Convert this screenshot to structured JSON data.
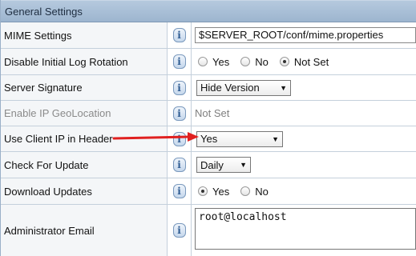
{
  "section_title": "General Settings",
  "rows": {
    "mime": {
      "label": "MIME Settings",
      "value": "$SERVER_ROOT/conf/mime.properties"
    },
    "log_rotation": {
      "label": "Disable Initial Log Rotation",
      "options": [
        "Yes",
        "No",
        "Not Set"
      ],
      "selected": "Not Set"
    },
    "server_signature": {
      "label": "Server Signature",
      "value": "Hide Version"
    },
    "geo_location": {
      "label": "Enable IP GeoLocation",
      "value": "Not Set"
    },
    "client_ip_header": {
      "label": "Use Client IP in Header",
      "value": "Yes"
    },
    "check_update": {
      "label": "Check For Update",
      "value": "Daily"
    },
    "download_updates": {
      "label": "Download Updates",
      "options": [
        "Yes",
        "No"
      ],
      "selected": "Yes"
    },
    "admin_email": {
      "label": "Administrator Email",
      "value": "root@localhost"
    }
  },
  "icons": {
    "help": "help-info-icon",
    "dropdown": "chevron-down-icon",
    "annotation_arrow": "arrow-right-icon"
  },
  "colors": {
    "header_bg": "#a9bfd7",
    "arrow": "#e02020"
  }
}
